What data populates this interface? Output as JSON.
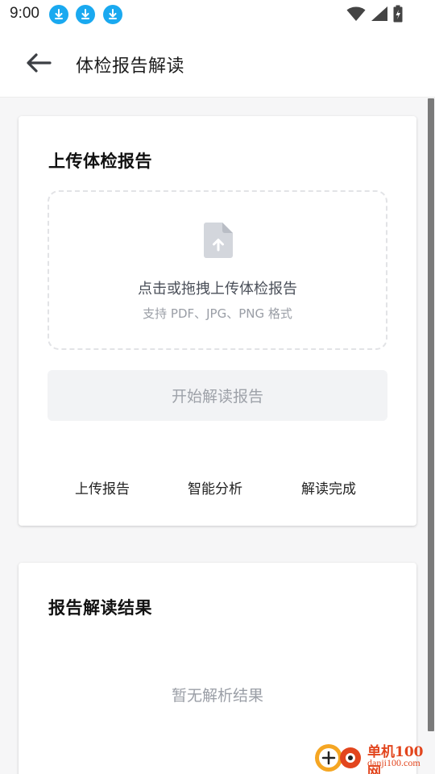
{
  "status_bar": {
    "time": "9:00",
    "icons": [
      "download-icon",
      "download-icon",
      "download-icon",
      "wifi-icon",
      "signal-icon",
      "battery-icon"
    ]
  },
  "app_bar": {
    "back_icon": "arrow-left-icon",
    "title": "体检报告解读"
  },
  "upload_card": {
    "title": "上传体检报告",
    "upload_icon": "file-upload-icon",
    "drop_main": "点击或拖拽上传体检报告",
    "drop_sub": "支持 PDF、JPG、PNG 格式",
    "start_button": "开始解读报告",
    "steps": [
      "上传报告",
      "智能分析",
      "解读完成"
    ]
  },
  "result_card": {
    "title": "报告解读结果",
    "empty": "暂无解析结果"
  },
  "watermark": {
    "name": "单机100网",
    "domain": "danji100.com"
  },
  "colors": {
    "accent_download": "#1aa9f0",
    "disabled_button_bg": "#f2f3f5",
    "muted_text": "#9a9ea6",
    "watermark": "#e2451d"
  }
}
